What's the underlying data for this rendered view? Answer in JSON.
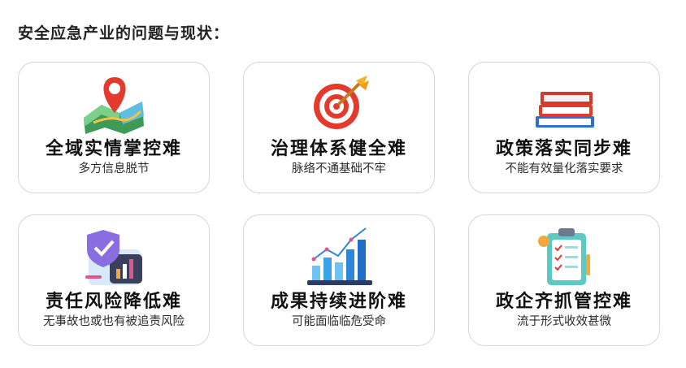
{
  "heading": "安全应急产业的问题与现状：",
  "cards": [
    {
      "title": "全域实情掌控难",
      "subtitle": "多方信息脱节",
      "icon": "map-pin-icon"
    },
    {
      "title": "治理体系健全难",
      "subtitle": "脉络不通基础不牢",
      "icon": "target-dart-icon"
    },
    {
      "title": "政策落实同步难",
      "subtitle": "不能有效量化落实要求",
      "icon": "books-icon"
    },
    {
      "title": "责任风险降低难",
      "subtitle": "无事故也或也有被追责风险",
      "icon": "shield-chart-icon"
    },
    {
      "title": "成果持续进阶难",
      "subtitle": "可能面临临危受命",
      "icon": "growth-bar-chart-icon"
    },
    {
      "title": "政企齐抓管控难",
      "subtitle": "流于形式收效甚微",
      "icon": "clipboard-checklist-icon"
    }
  ],
  "colors": {
    "border": "#d6d6d6",
    "red": "#e23b2e",
    "blue": "#2f7fd8",
    "green": "#3cb371",
    "teal": "#5cc9c4"
  }
}
